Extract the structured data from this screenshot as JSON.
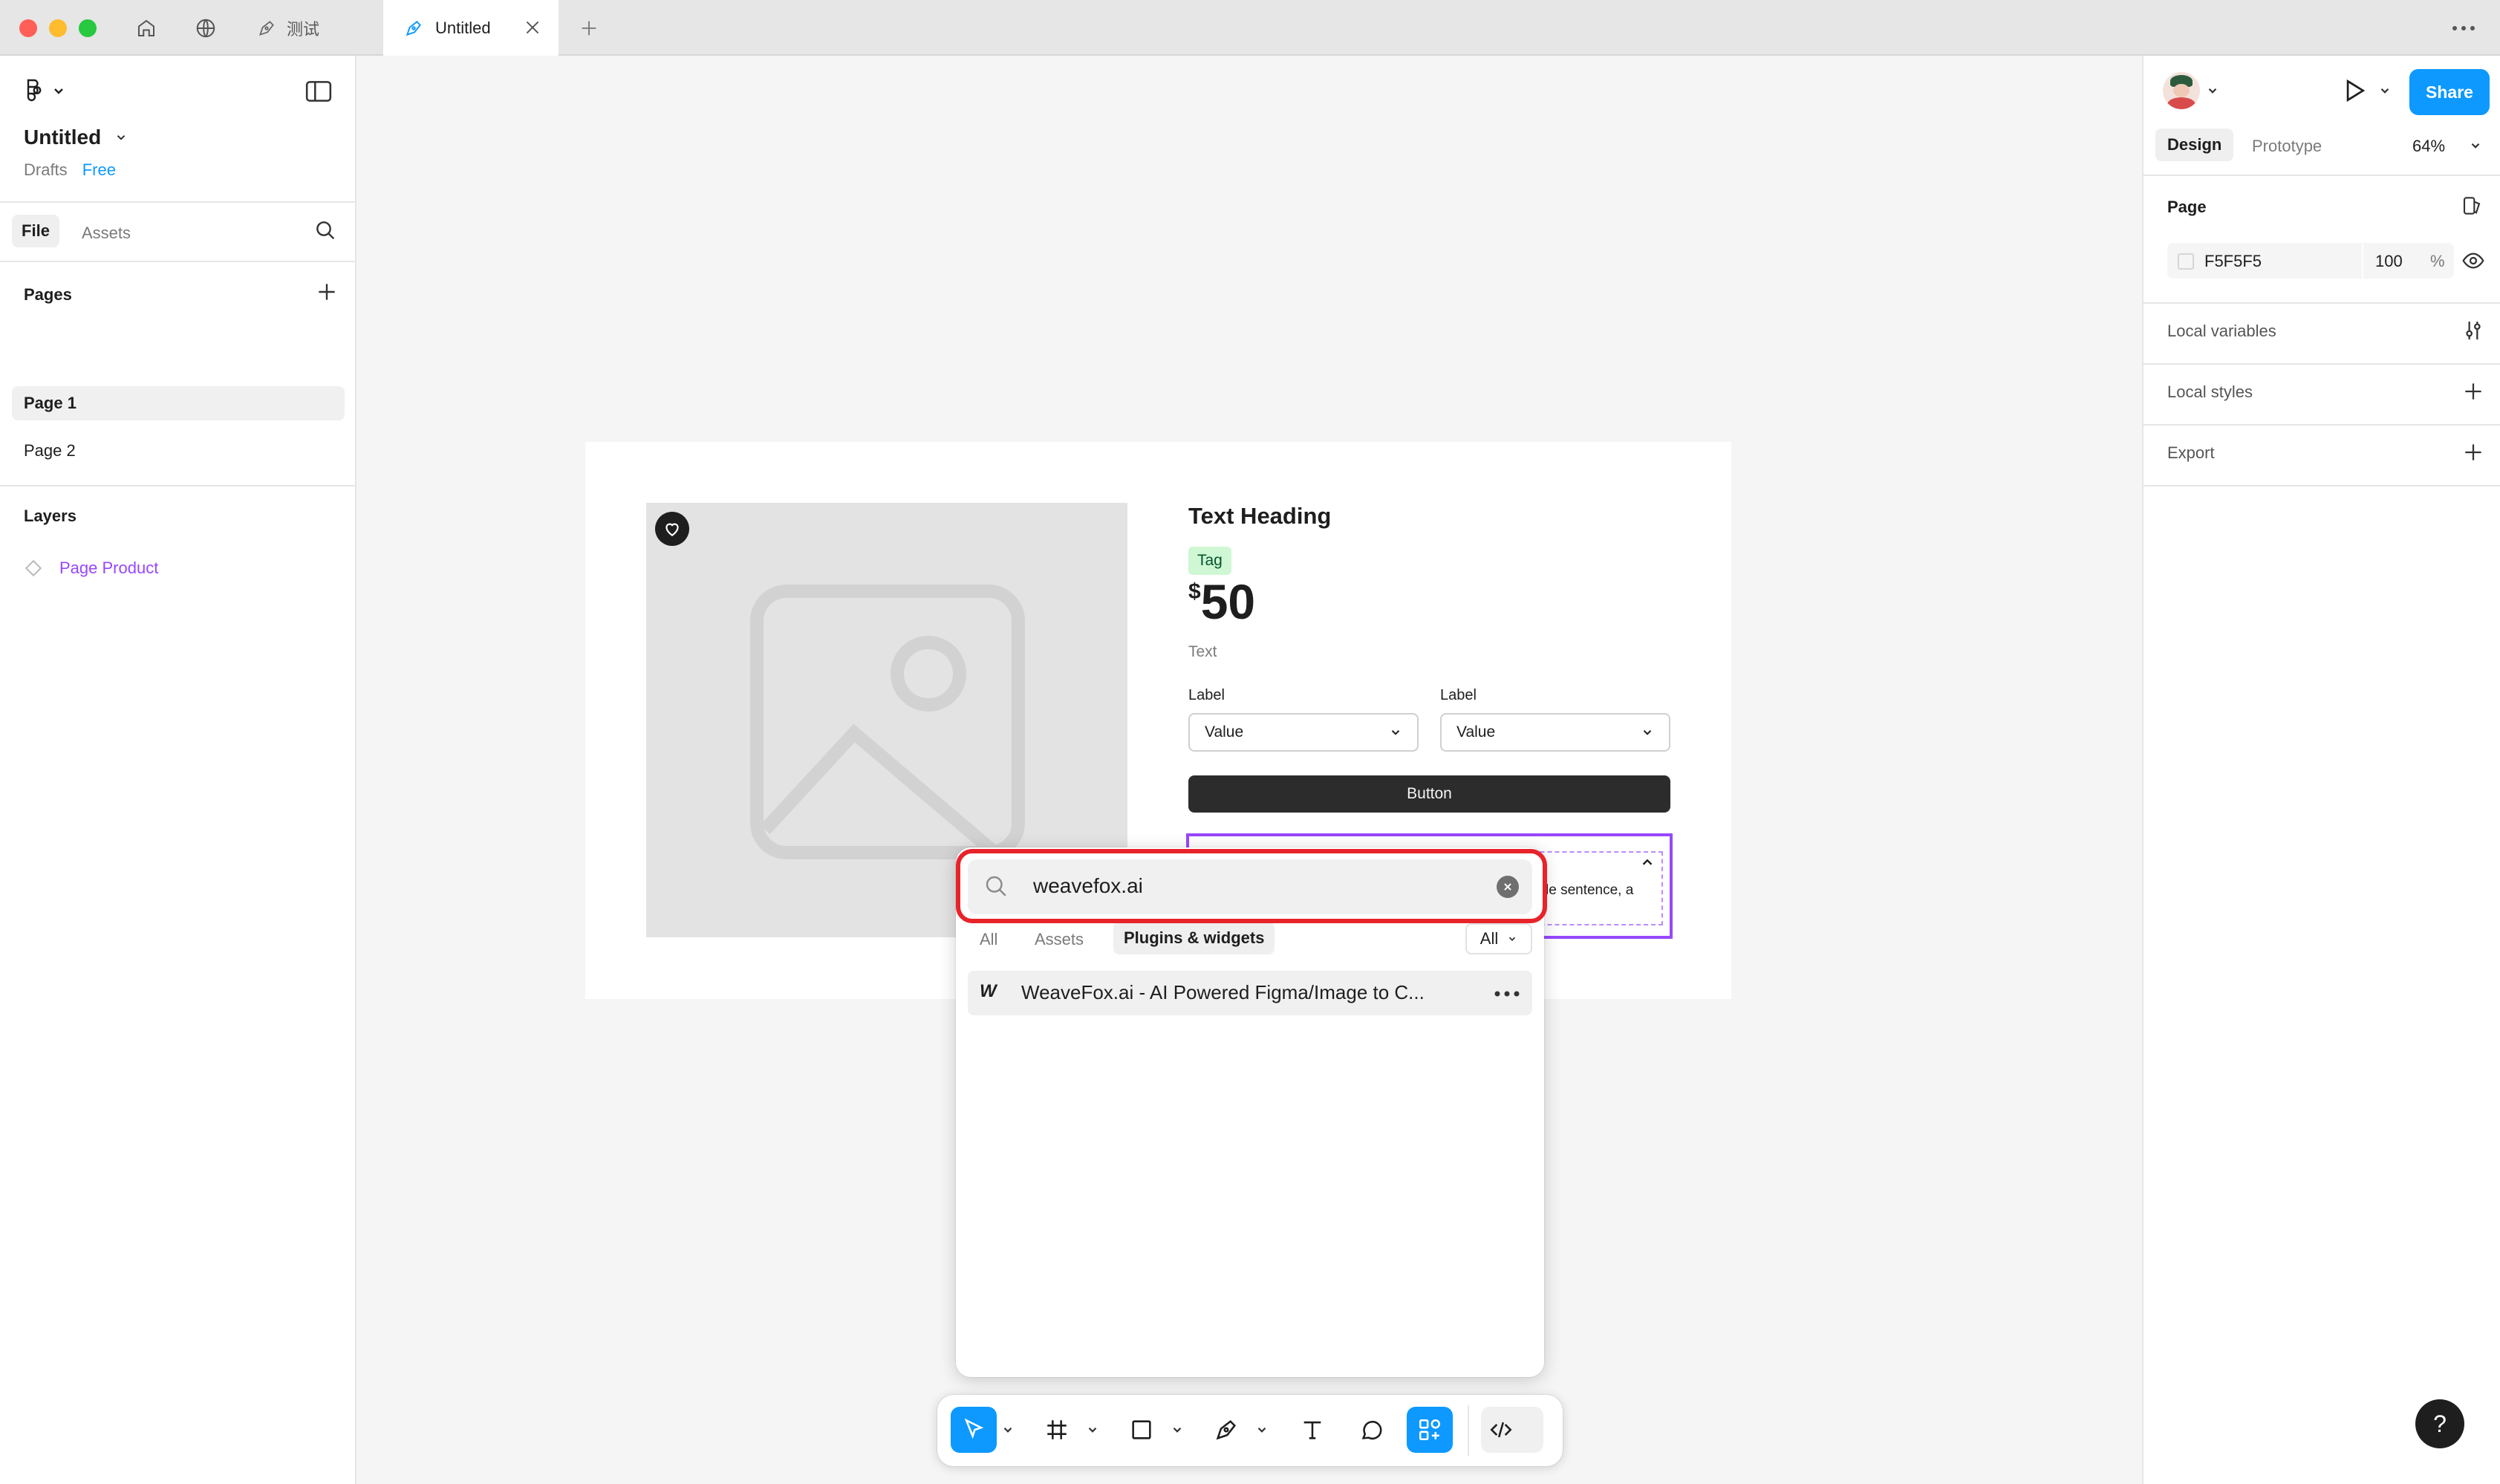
{
  "window": {
    "tabs": [
      {
        "label": "测试",
        "active": false
      },
      {
        "label": "Untitled",
        "active": true
      }
    ]
  },
  "left_panel": {
    "file_title": "Untitled",
    "drafts_label": "Drafts",
    "plan_badge": "Free",
    "tabs": [
      "File",
      "Assets"
    ],
    "pages_heading": "Pages",
    "pages": [
      "Page 1",
      "Page 2"
    ],
    "layers_heading": "Layers",
    "layers": [
      "Page Product"
    ]
  },
  "canvas": {
    "heading": "Text Heading",
    "tag": "Tag",
    "price_currency": "$",
    "price_value": "50",
    "body_text": "Text",
    "select1": {
      "label": "Label",
      "value": "Value"
    },
    "select2": {
      "label": "Label",
      "value": "Value"
    },
    "button_label": "Button",
    "accordion_snippet": "le sentence, a"
  },
  "search_popup": {
    "query": "weavefox.ai",
    "filters": [
      "All",
      "Assets",
      "Plugins & widgets"
    ],
    "active_filter": "Plugins & widgets",
    "scope_dropdown": "All",
    "results": [
      {
        "icon_letter": "W",
        "title": "WeaveFox.ai - AI Powered Figma/Image to C..."
      }
    ]
  },
  "right_panel": {
    "play_label": "Present",
    "share_label": "Share",
    "tabs": [
      "Design",
      "Prototype"
    ],
    "active_tab": "Design",
    "zoom": "64%",
    "page_heading": "Page",
    "page_color": "F5F5F5",
    "page_opacity": "100",
    "percent_sign": "%",
    "sections": [
      "Local variables",
      "Local styles",
      "Export"
    ]
  },
  "help_label": "?",
  "colors": {
    "accent_blue": "#0d99ff",
    "purple": "#9747ff",
    "highlight_red": "#e8232a",
    "tag_green_bg": "#cff7d3",
    "tag_green_text": "#02542d"
  }
}
